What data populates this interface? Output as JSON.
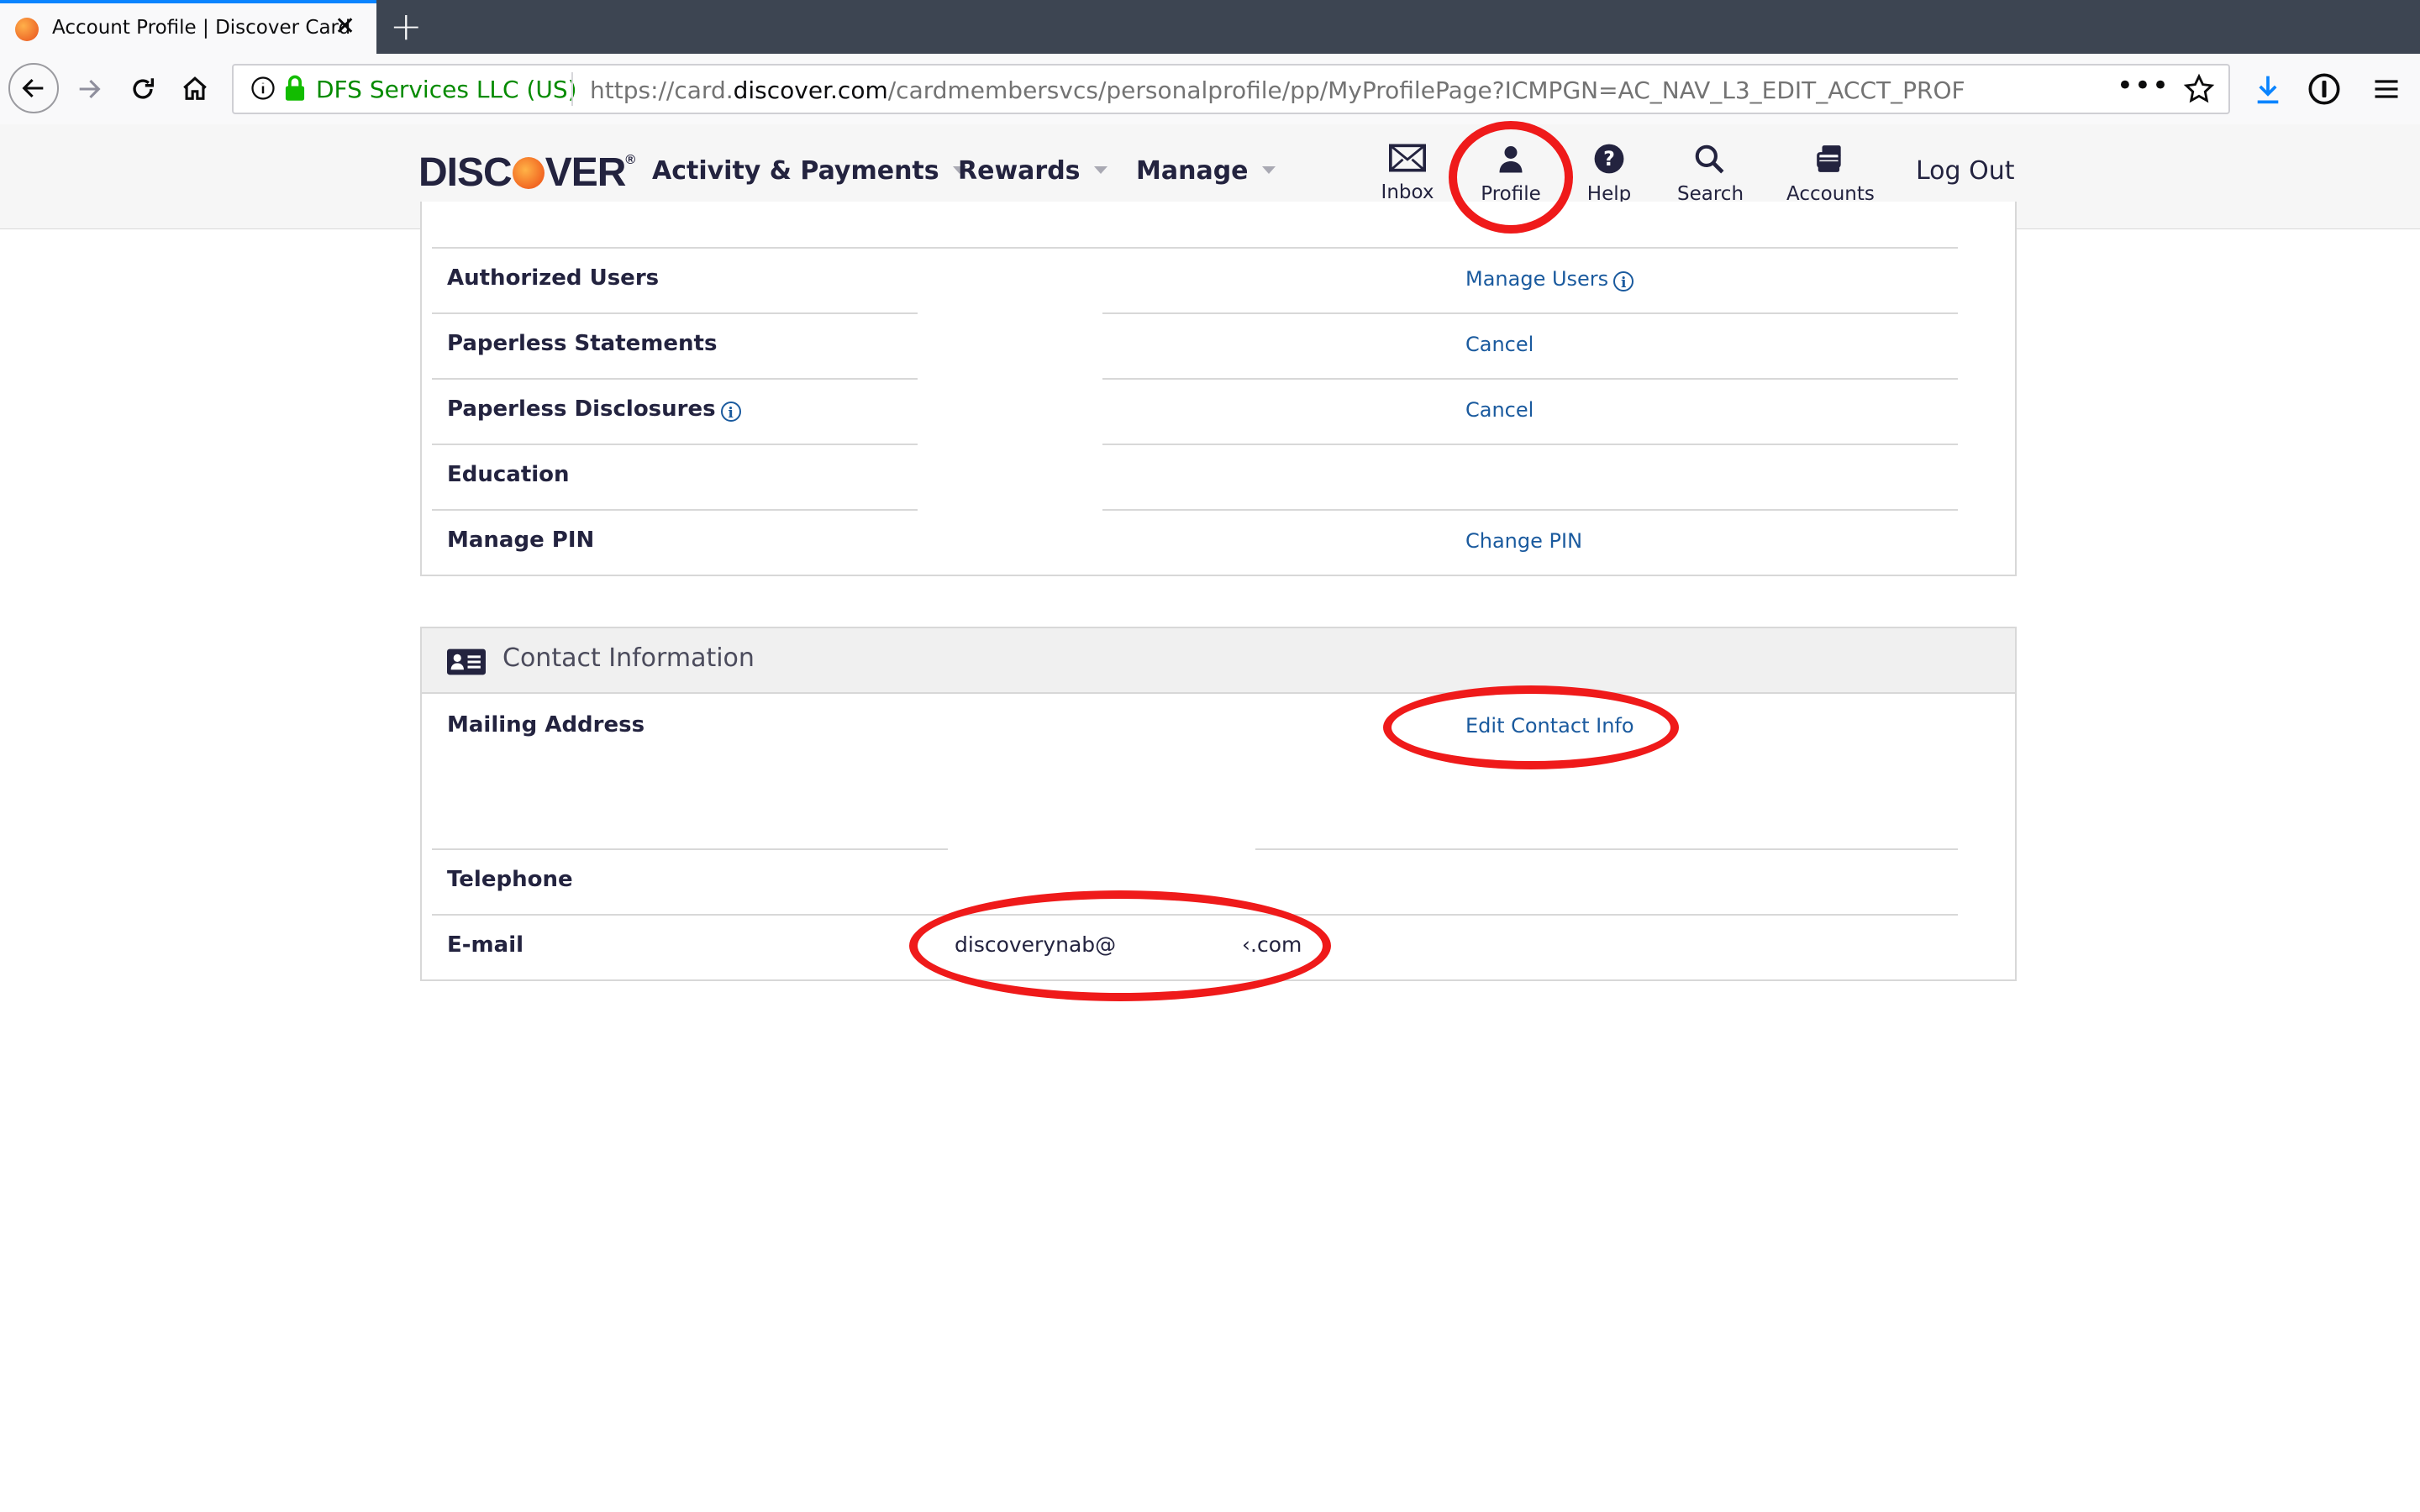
{
  "browser": {
    "tab_title": "Account Profile | Discover Card",
    "url_org": "DFS Services LLC (US)",
    "url_prefix": "https://card.",
    "url_domain": "discover.com",
    "url_path": "/cardmembersvcs/personalprofile/pp/MyProfilePage?ICMPGN=AC_NAV_L3_EDIT_ACCT_PROF",
    "url_more": "•••"
  },
  "header": {
    "logo_pre": "DISC",
    "logo_post": "VER",
    "menu": [
      "Activity & Payments",
      "Rewards",
      "Manage"
    ],
    "icons": {
      "inbox": "Inbox",
      "profile": "Profile",
      "help": "Help",
      "search": "Search",
      "accounts": "Accounts"
    },
    "logout": "Log Out"
  },
  "account_settings": {
    "rows": [
      {
        "label": "Authorized Users",
        "link": "Manage Users"
      },
      {
        "label": "Paperless Statements",
        "link": "Cancel"
      },
      {
        "label": "Paperless Disclosures",
        "link": "Cancel"
      },
      {
        "label": "Education",
        "link": ""
      },
      {
        "label": "Manage PIN",
        "link": "Change PIN"
      }
    ]
  },
  "contact": {
    "title": "Contact Information",
    "mailing_label": "Mailing Address",
    "edit_link": "Edit Contact Info",
    "telephone_label": "Telephone",
    "email_label": "E-mail",
    "email_start": "discoverynab@",
    "email_end": "‹.com"
  },
  "colors": {
    "annotation": "#ef1a1a",
    "link": "#1a5a9e",
    "brand_orange": "#f26722"
  }
}
